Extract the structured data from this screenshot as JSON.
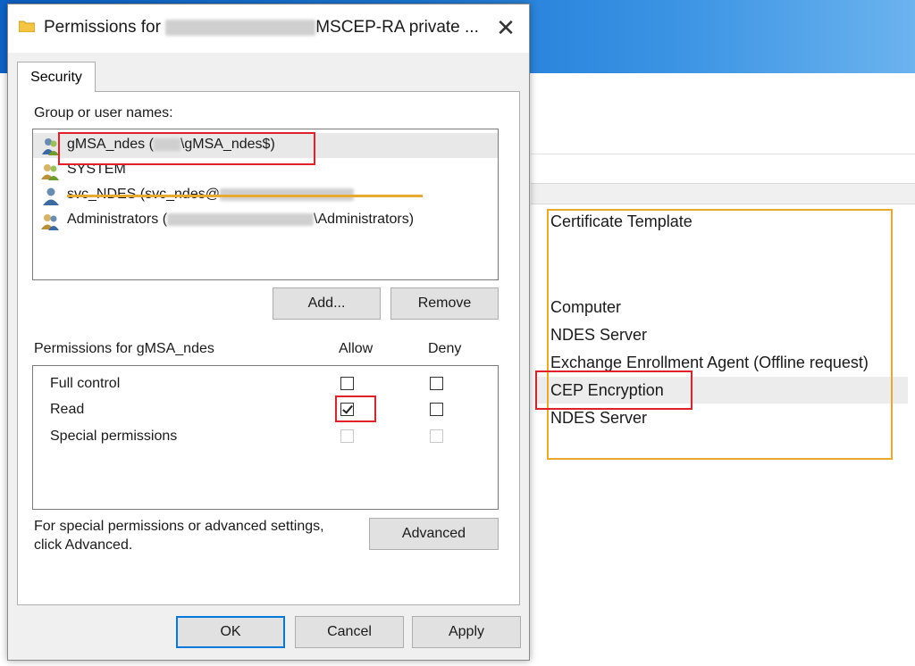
{
  "dialog": {
    "title_prefix": "Permissions for",
    "title_suffix": "MSCEP-RA private ...",
    "close_glyph": "✕",
    "tabs": [
      {
        "label": "Security"
      }
    ],
    "group_label": "Group or user names:",
    "users": [
      {
        "name_prefix": "gMSA_ndes (",
        "name_suffix": "\\gMSA_ndes$)",
        "selected": true,
        "icon": "user-group-icon"
      },
      {
        "name_prefix": "SYSTEM",
        "name_suffix": "",
        "selected": false,
        "icon": "users-icon"
      },
      {
        "name_prefix": "svc_NDES (svc_ndes@",
        "name_suffix": "",
        "selected": false,
        "icon": "user-icon",
        "struck": true
      },
      {
        "name_prefix": "Administrators (",
        "name_suffix": "\\Administrators)",
        "selected": false,
        "icon": "users-icon"
      }
    ],
    "add_label": "Add...",
    "remove_label": "Remove",
    "permissions_label": "Permissions for gMSA_ndes",
    "allow_label": "Allow",
    "deny_label": "Deny",
    "permissions": [
      {
        "name": "Full control",
        "allow": false,
        "deny": false,
        "disabled": false
      },
      {
        "name": "Read",
        "allow": true,
        "deny": false,
        "disabled": false
      },
      {
        "name": "Special permissions",
        "allow": false,
        "deny": false,
        "disabled": true
      }
    ],
    "advanced_text_line1": "For special permissions or advanced settings,",
    "advanced_text_line2": "click Advanced.",
    "advanced_label": "Advanced",
    "ok_label": "OK",
    "cancel_label": "Cancel",
    "apply_label": "Apply"
  },
  "template_list": {
    "items": [
      "Certificate Template",
      "Computer",
      "NDES Server",
      "Exchange Enrollment Agent (Offline request)",
      "CEP Encryption",
      "NDES Server"
    ]
  },
  "colors": {
    "highlight_red": "#e0202a",
    "highlight_orange": "#e8a92f",
    "accent_blue": "#0078d7"
  }
}
